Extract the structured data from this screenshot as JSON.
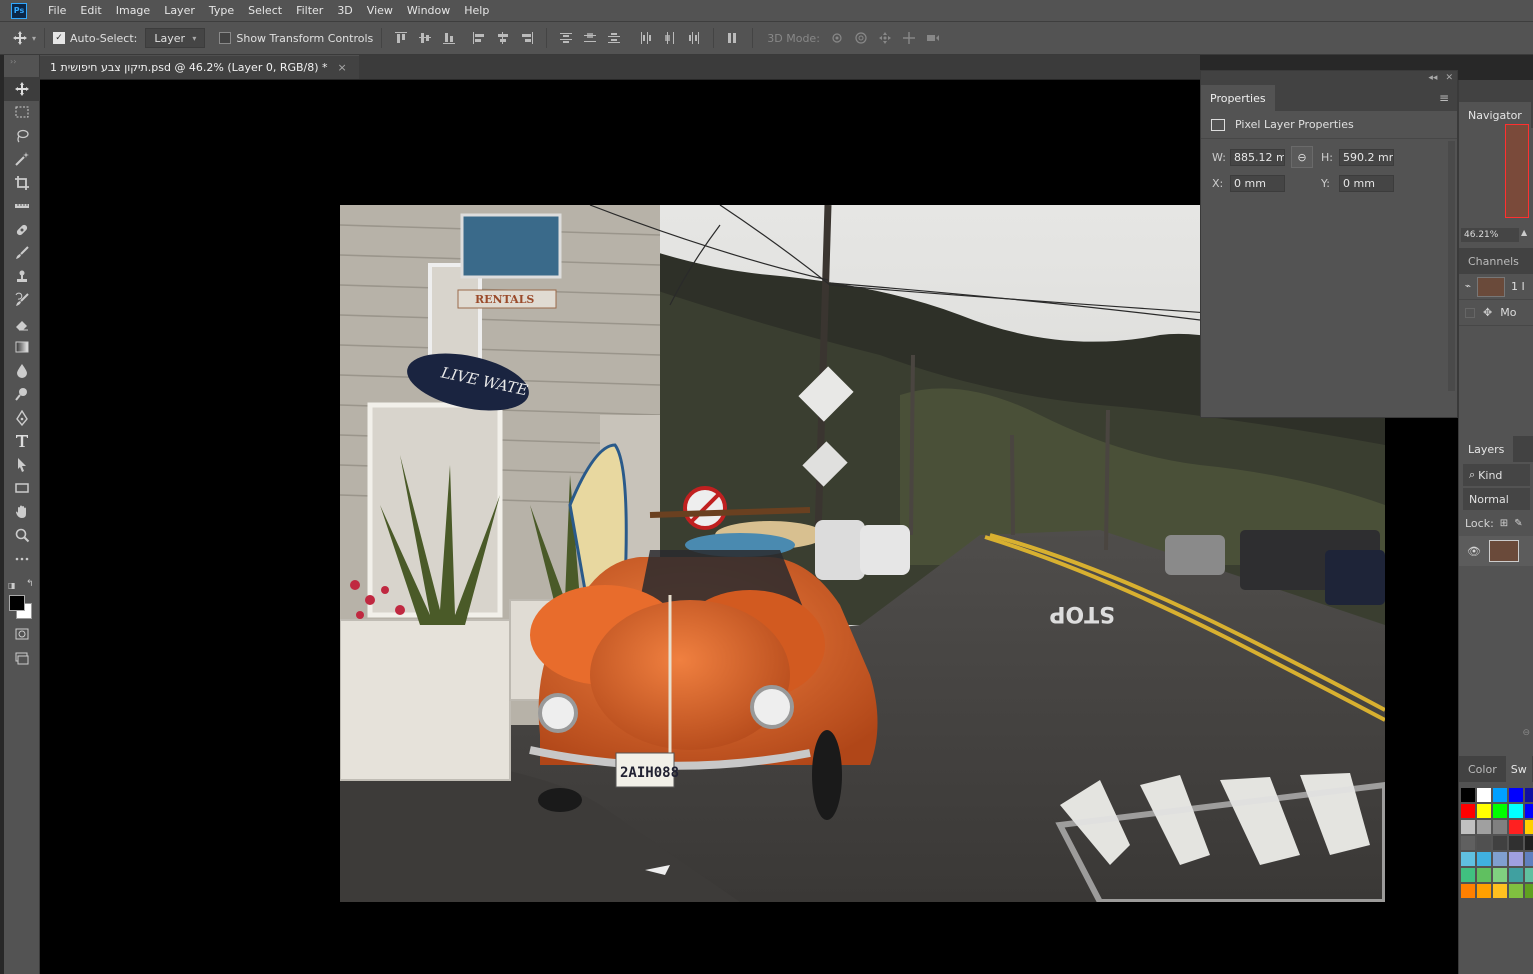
{
  "menu": {
    "logo": "Ps",
    "items": [
      "File",
      "Edit",
      "Image",
      "Layer",
      "Type",
      "Select",
      "Filter",
      "3D",
      "View",
      "Window",
      "Help"
    ]
  },
  "options": {
    "auto_select_label": "Auto-Select:",
    "auto_select_checked": true,
    "auto_select_target": "Layer",
    "show_transform_label": "Show Transform Controls",
    "mode_3d_label": "3D Mode:"
  },
  "document": {
    "tab_title": "1 תיקון צבע חיפושית.psd @ 46.2% (Layer 0, RGB/8) *",
    "close_glyph": "×"
  },
  "properties": {
    "tab_label": "Properties",
    "section_title": "Pixel Layer Properties",
    "w_label": "W:",
    "w_value": "885.12 mm",
    "h_label": "H:",
    "h_value": "590.2 mm",
    "x_label": "X:",
    "x_value": "0 mm",
    "y_label": "Y:",
    "y_value": "0 mm"
  },
  "navigator": {
    "tab_label": "Navigator",
    "zoom": "46.21%"
  },
  "channels": {
    "tab_label": "Channels",
    "rows": [
      "1 I",
      "Mo"
    ]
  },
  "layers": {
    "tab_label": "Layers",
    "kind_filter": "Kind",
    "blend_mode": "Normal",
    "lock_label": "Lock:"
  },
  "color_panel": {
    "tab_label": "Color",
    "tab2_label": "Sw",
    "swatches": [
      "#000000",
      "#ffffff",
      "#00a0ff",
      "#0000ff",
      "#1010a0",
      "#ff0000",
      "#ffff00",
      "#00ff00",
      "#00ffff",
      "#0000ff",
      "#c0c0c0",
      "#a0a0a0",
      "#808080",
      "#ff2020",
      "#ffd000",
      "#606060",
      "#505050",
      "#404040",
      "#303030",
      "#202020",
      "#60c0e0",
      "#40b0e0",
      "#80a0d0",
      "#a0a0e0",
      "#6080c0",
      "#40c080",
      "#60c060",
      "#80d080",
      "#40a0a0",
      "#60c0a0",
      "#ff8000",
      "#ffa000",
      "#ffc020",
      "#80c040",
      "#60a020"
    ]
  },
  "icons": {
    "tools": [
      "move-icon",
      "marquee-icon",
      "lasso-icon",
      "magic-wand-icon",
      "crop-icon",
      "ruler-icon",
      "healing-icon",
      "brush-icon",
      "stamp-icon",
      "history-brush-icon",
      "eraser-icon",
      "gradient-icon",
      "blur-icon",
      "dodge-icon",
      "pen-icon",
      "type-icon",
      "path-select-icon",
      "rectangle-icon",
      "hand-icon",
      "zoom-icon",
      "more-icon"
    ]
  }
}
